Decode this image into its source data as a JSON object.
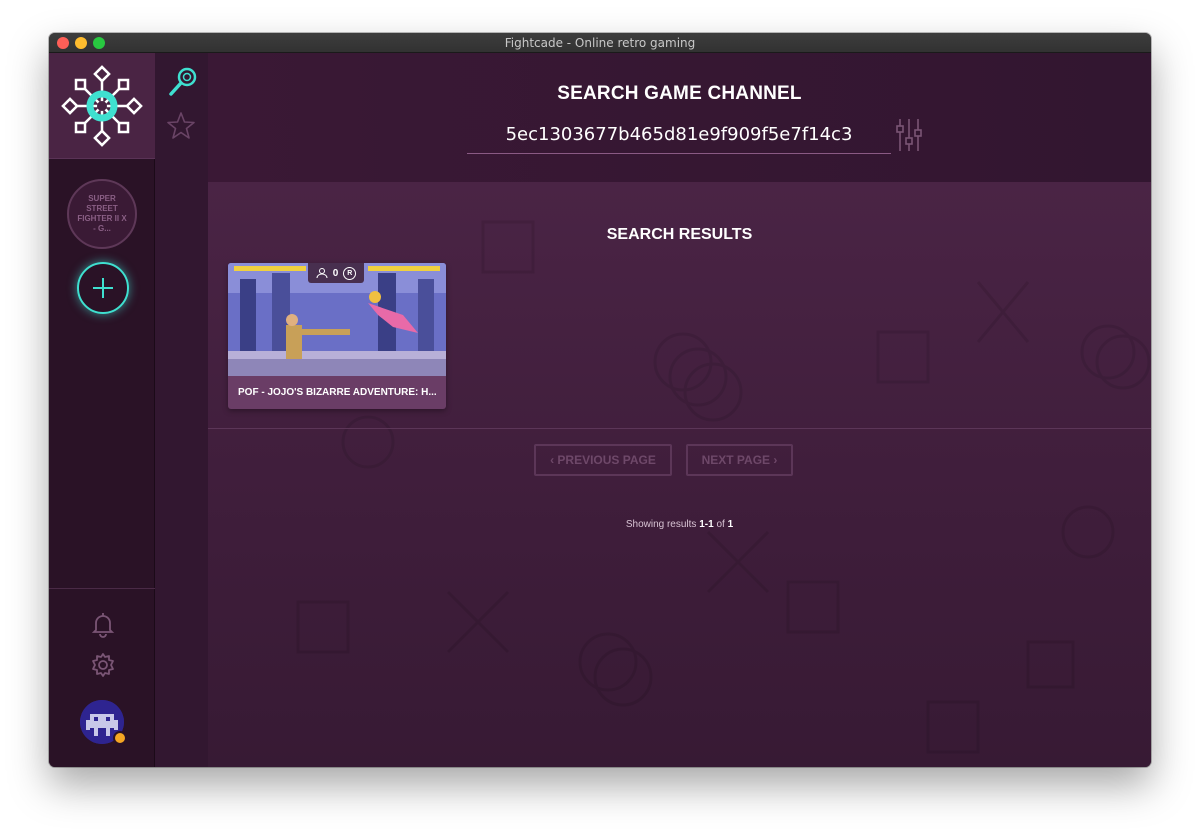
{
  "window": {
    "title": "Fightcade - Online retro gaming"
  },
  "sidebar": {
    "channel_label": "SUPER STREET FIGHTER II X - G...",
    "add_icon": "plus-icon",
    "bell_icon": "bell-icon",
    "gear_icon": "gear-icon"
  },
  "strip": {
    "search_icon": "search-icon",
    "star_icon": "star-icon"
  },
  "header": {
    "title": "SEARCH GAME CHANNEL",
    "search_value": "5ec1303677b465d81e9f909f5e7f14c3"
  },
  "results": {
    "title": "SEARCH RESULTS",
    "card": {
      "players": "0",
      "ranked_badge": "R",
      "title": "POF - JOJO'S BIZARRE ADVENTURE: H..."
    },
    "prev_label": "‹ PREVIOUS PAGE",
    "next_label": "NEXT PAGE ›",
    "count_prefix": "Showing results ",
    "count_range": "1-1",
    "count_of": " of ",
    "count_total": "1"
  },
  "colors": {
    "accent": "#3fe0d0",
    "status": "#f5a623",
    "bg": "#3e1d3a"
  }
}
